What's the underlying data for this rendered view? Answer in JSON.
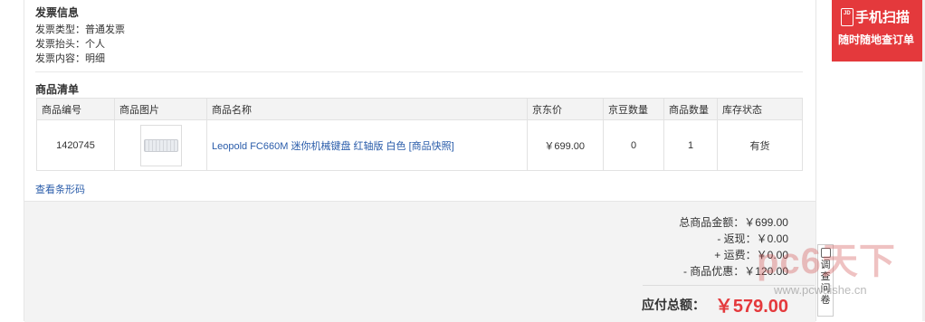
{
  "invoice": {
    "title": "发票信息",
    "type_line": "发票类型：普通发票",
    "header_line": "发票抬头：个人",
    "content_line": "发票内容：明细"
  },
  "goods": {
    "title": "商品清单",
    "columns": [
      "商品编号",
      "商品图片",
      "商品名称",
      "京东价",
      "京豆数量",
      "商品数量",
      "库存状态"
    ],
    "rows": [
      {
        "id": "1420745",
        "image": "keyboard-thumbnail",
        "name": "Leopold FC660M 迷你机械键盘 红轴版 白色 [商品快照]",
        "price": "￥699.00",
        "beans": "0",
        "qty": "1",
        "stock": "有货"
      }
    ],
    "barcode_link": "查看条形码"
  },
  "summary": {
    "total_goods": "总商品金额：￥699.00",
    "cashback": "- 返现：￥0.00",
    "shipping": "+ 运费：￥0.00",
    "discount": "- 商品优惠：￥120.00",
    "payable_label": "应付总额：",
    "payable_value": "￥579.00"
  },
  "promo": {
    "icon_text": "JD",
    "line1": "手机扫描",
    "line2": "随时随地查订单"
  },
  "survey": {
    "label": "调查问卷"
  },
  "watermark": {
    "text": "pc6天下",
    "url": "www.pcwaishe.cn"
  },
  "colors": {
    "accent_red": "#e4393c",
    "link_blue": "#2a5caa",
    "header_bg": "#f3f3f3"
  }
}
